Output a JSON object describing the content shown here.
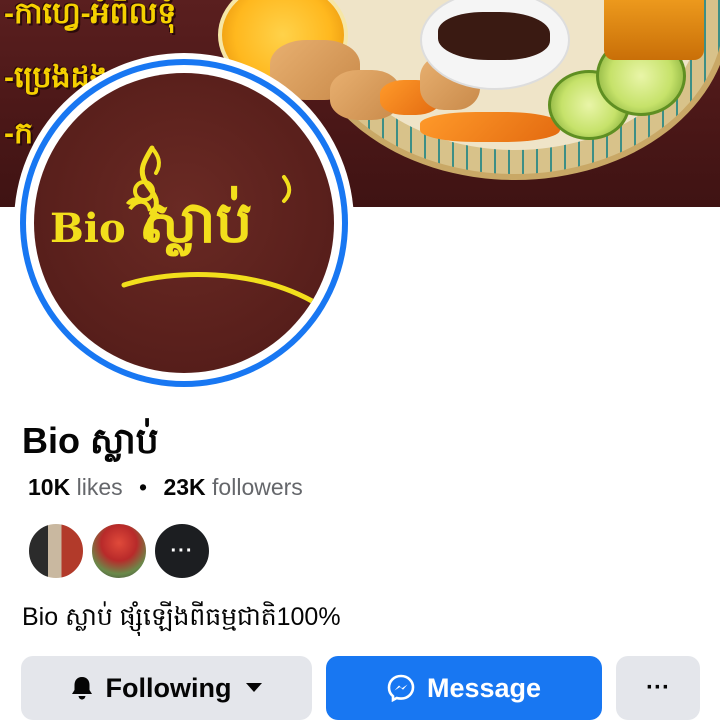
{
  "cover": {
    "promo_lines": [
      "-កាហ្វេ-អំពិលទុំ",
      "-ប្រេងដូង",
      "-ក"
    ]
  },
  "profile": {
    "logo_text_latin": "Bio",
    "logo_text_khmer": "ស្លាប់",
    "name": "Bio ស្លាប់",
    "likes_count": "10K",
    "likes_label": "likes",
    "followers_count": "23K",
    "followers_label": "followers",
    "more_friends_label": "···",
    "bio": "Bio ស្លាប់ ផ្សុំឡើងពីធម្មជាតិ100%"
  },
  "actions": {
    "following_label": "Following",
    "message_label": "Message",
    "more_label": "···"
  },
  "colors": {
    "accent_blue": "#1877f2",
    "button_gray": "#e4e6eb",
    "logo_yellow": "#f2df1c",
    "logo_bg": "#5a201c"
  }
}
